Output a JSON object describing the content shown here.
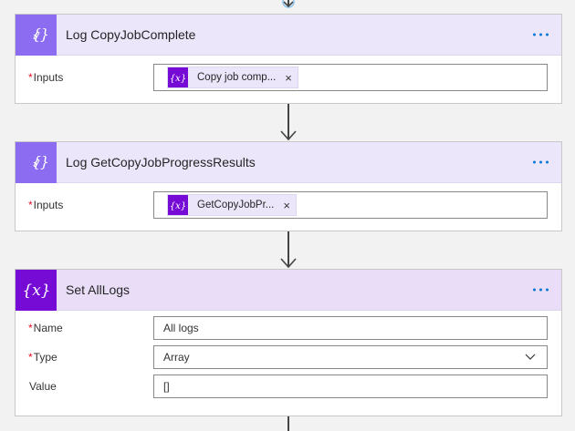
{
  "cards": [
    {
      "title": "Log CopyJobComplete",
      "fields": [
        {
          "label": "Inputs",
          "required": "*",
          "token": "Copy job comp...",
          "token_close": "×"
        }
      ]
    },
    {
      "title": "Log GetCopyJobProgressResults",
      "fields": [
        {
          "label": "Inputs",
          "required": "*",
          "token": "GetCopyJobPr...",
          "token_close": "×"
        }
      ]
    },
    {
      "title": "Set AllLogs",
      "fields": [
        {
          "label": "Name",
          "required": "*",
          "value": "All logs"
        },
        {
          "label": "Type",
          "required": "*",
          "value": "Array"
        },
        {
          "label": "Value",
          "required": "",
          "value": "[]"
        }
      ]
    }
  ],
  "colors": {
    "accent": "#0078d4",
    "variable_icon_light": "#8c6cf0",
    "variable_icon_dark": "#770bd6",
    "header_bg": "#ece6fb",
    "required": "#e81123"
  },
  "icons": {
    "variable": "variable-curly-brace-icon",
    "more": "more-options-icon",
    "chevron": "chevron-down-icon"
  }
}
